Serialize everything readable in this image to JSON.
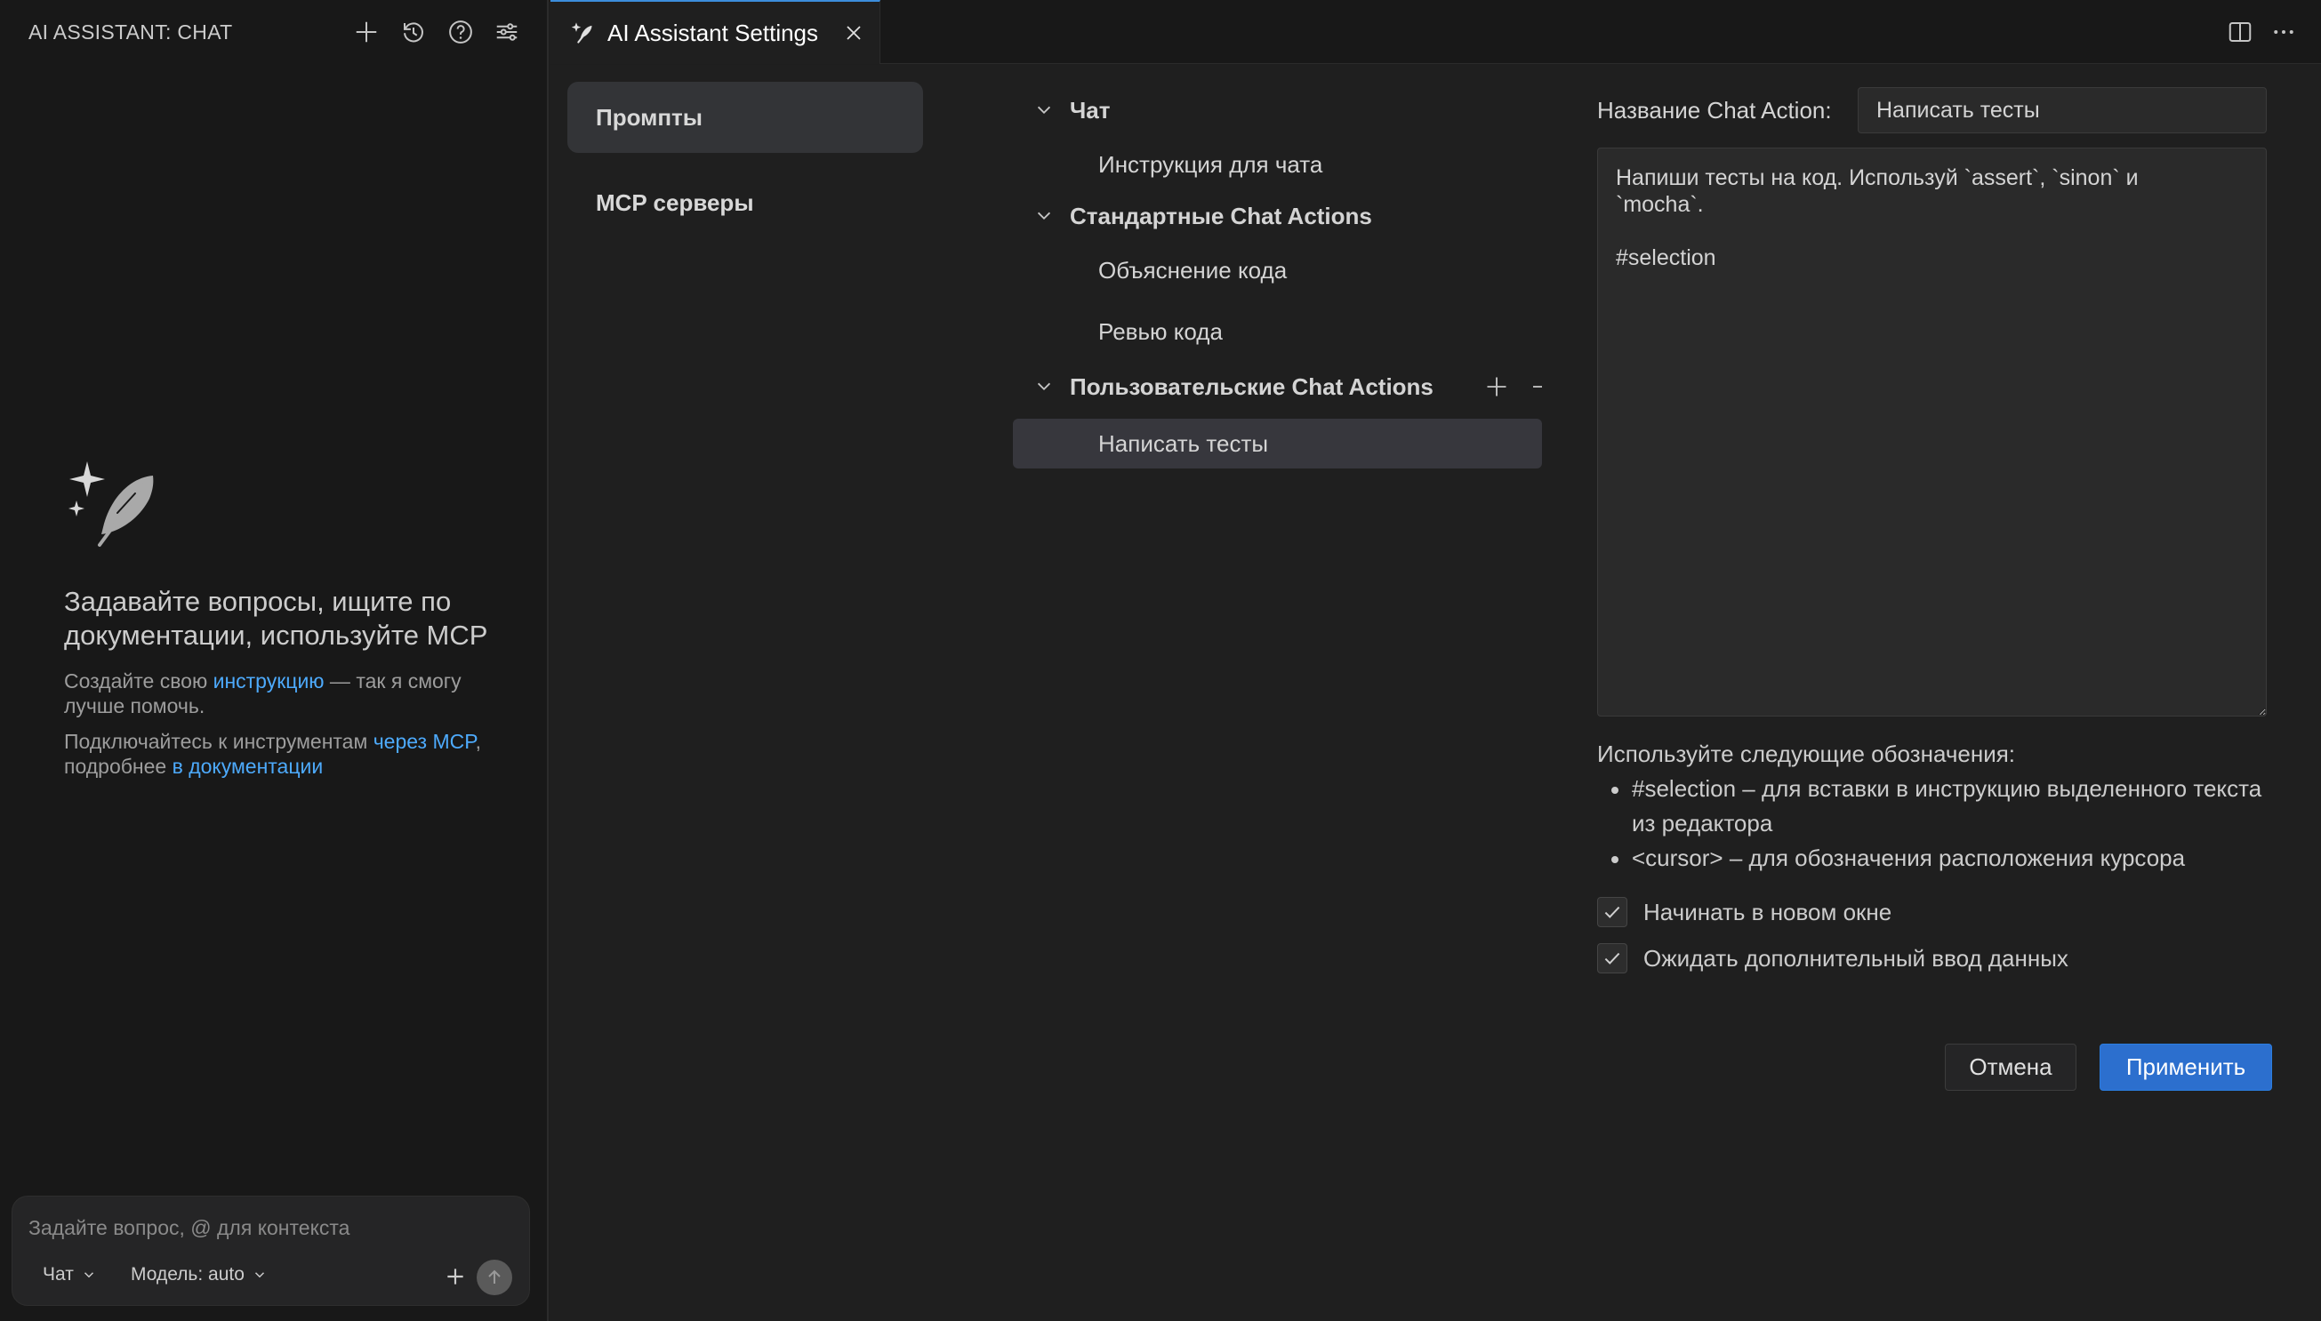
{
  "chat_panel": {
    "title": "AI ASSISTANT: CHAT",
    "header_icons": [
      "plus-icon",
      "history-icon",
      "help-icon",
      "settings-sliders-icon"
    ],
    "empty_title": "Задавайте вопросы, ищите по документации, используйте MCP",
    "p1_before": "Создайте свою ",
    "p1_link": "инструкцию",
    "p1_after": " — так я смогу лучше помочь.",
    "p2_before": "Подключайтесь к инструментам ",
    "p2_link1": "через MCP",
    "p2_middle": ", подробнее ",
    "p2_link2": "в документации",
    "input_placeholder": "Задайте вопрос, @ для контекста",
    "mode_label": "Чат",
    "model_label": "Модель: auto"
  },
  "tab": {
    "label": "AI Assistant Settings"
  },
  "side_nav": {
    "items": [
      {
        "label": "Промпты",
        "active": true
      },
      {
        "label": "MCP серверы",
        "active": false
      }
    ]
  },
  "tree": {
    "groups": [
      {
        "label": "Чат",
        "items": [
          "Инструкция для чата"
        ]
      },
      {
        "label": "Стандартные Chat Actions",
        "items": [
          "Объяснение кода",
          "Ревью кода"
        ]
      },
      {
        "label": "Пользовательские Chat Actions",
        "items": [
          "Написать тесты"
        ]
      }
    ],
    "selected_item": "Написать тесты"
  },
  "form": {
    "name_label": "Название Chat Action:",
    "name_value": "Написать тесты",
    "prompt_text": "Напиши тесты на код. Используй `assert`, `sinon` и\n`mocha`.\n\n#selection",
    "hint_title": "Используйте следующие обозначения:",
    "hints": [
      "#selection – для вставки в инструкцию выделенного текста из редактора",
      "<cursor> – для обозначения расположения курсора"
    ],
    "checkboxes": [
      {
        "label": "Начинать в новом окне",
        "checked": true
      },
      {
        "label": "Ожидать дополнительный ввод данных",
        "checked": true
      }
    ],
    "cancel_label": "Отмена",
    "apply_label": "Применить"
  },
  "colors": {
    "accent": "#2c6fce",
    "link": "#4daafc",
    "background": "#1f1f1f",
    "sidebar_background": "#181818"
  }
}
